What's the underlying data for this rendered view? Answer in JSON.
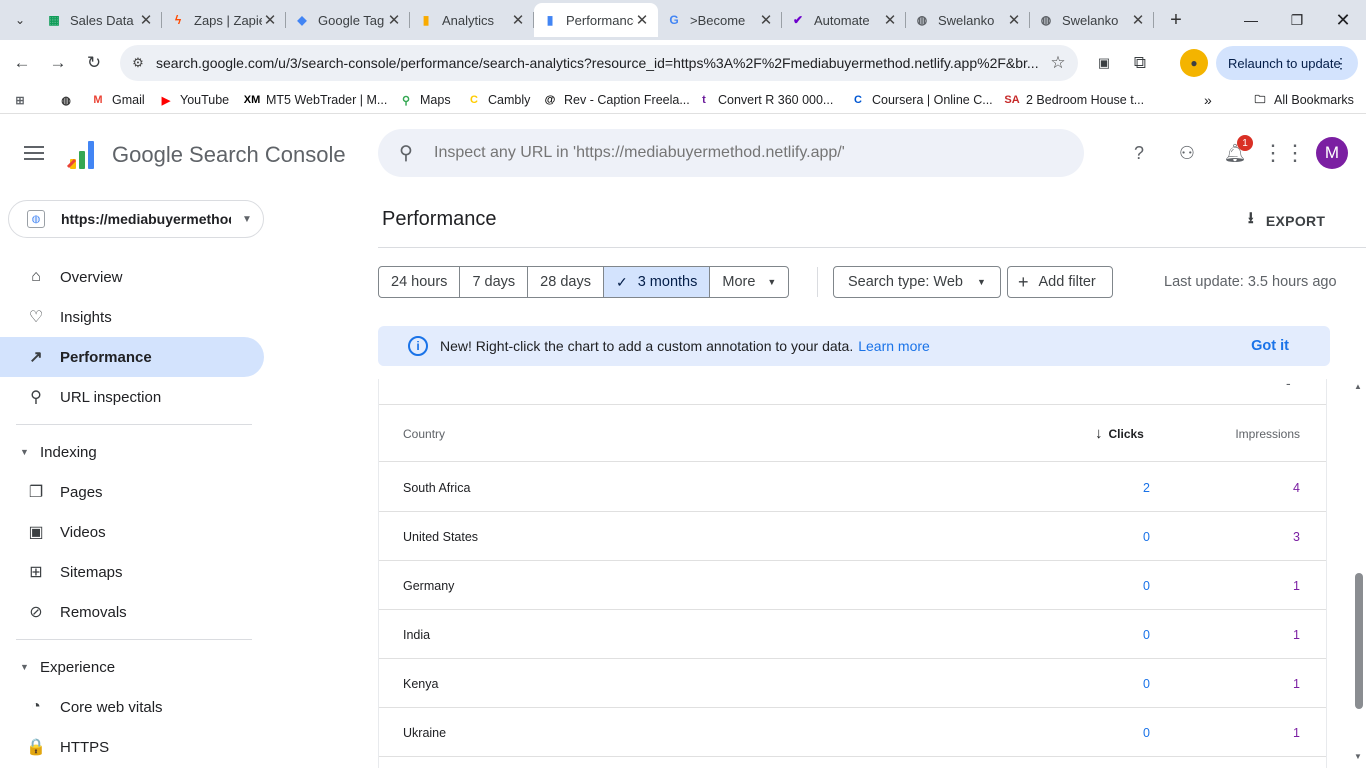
{
  "browser": {
    "tabs": [
      {
        "title": "Sales Data",
        "favicon": "sheets-icon",
        "color": "#0f9d58",
        "glyph": "▦"
      },
      {
        "title": "Zaps | Zapier",
        "favicon": "zapier-icon",
        "color": "#ff4a00",
        "glyph": "ϟ"
      },
      {
        "title": "Google Tag",
        "favicon": "tag-manager-icon",
        "color": "#4285f4",
        "glyph": "◆"
      },
      {
        "title": "Analytics",
        "favicon": "analytics-icon",
        "color": "#f9ab00",
        "glyph": "▮"
      },
      {
        "title": "Performance",
        "favicon": "search-console-icon",
        "color": "#4285f4",
        "glyph": "▮",
        "active": true
      },
      {
        "title": ">Become",
        "favicon": "google-icon",
        "color": "#4285f4",
        "glyph": "G"
      },
      {
        "title": "Automate",
        "favicon": "make-icon",
        "color": "#6d00cc",
        "glyph": "✔"
      },
      {
        "title": "Swelanko",
        "favicon": "globe-icon",
        "color": "#5f6368",
        "glyph": "◍"
      },
      {
        "title": "Swelanko",
        "favicon": "globe-icon",
        "color": "#5f6368",
        "glyph": "◍"
      }
    ],
    "url": "search.google.com/u/3/search-console/performance/search-analytics?resource_id=https%3A%2F%2Fmediabuyermethod.netlify.app%2F&br...",
    "relaunch_label": "Relaunch to update",
    "bookmarks": [
      {
        "label": "",
        "icon": "globe-icon",
        "glyph": "◍",
        "color": "#333"
      },
      {
        "label": "Gmail",
        "icon": "gmail-icon",
        "glyph": "M",
        "color": "#ea4335"
      },
      {
        "label": "YouTube",
        "icon": "youtube-icon",
        "glyph": "▶",
        "color": "#ff0000"
      },
      {
        "label": "MT5 WebTrader | M...",
        "icon": "xm-icon",
        "glyph": "XM",
        "color": "#000"
      },
      {
        "label": "Maps",
        "icon": "maps-icon",
        "glyph": "⚲",
        "color": "#34a853"
      },
      {
        "label": "Cambly",
        "icon": "cambly-icon",
        "glyph": "C",
        "color": "#ffcc00"
      },
      {
        "label": "Rev - Caption Freela...",
        "icon": "rev-icon",
        "glyph": "@",
        "color": "#000"
      },
      {
        "label": "Convert R 360 000...",
        "icon": "t-icon",
        "glyph": "t",
        "color": "#6a1b9a"
      },
      {
        "label": "Coursera | Online C...",
        "icon": "coursera-icon",
        "glyph": "C",
        "color": "#0056d2"
      },
      {
        "label": "2 Bedroom House t...",
        "icon": "sa-icon",
        "glyph": "SA",
        "color": "#c62828"
      }
    ],
    "all_bookmarks_label": "All Bookmarks"
  },
  "header": {
    "product_name": "Google Search Console",
    "search_placeholder": "Inspect any URL in 'https://mediabuyermethod.netlify.app/'",
    "notification_count": "1",
    "avatar_letter": "M"
  },
  "sidebar": {
    "property": "https://mediabuyermethod.netlify.app/",
    "items": [
      {
        "label": "Overview",
        "icon": "home-icon",
        "glyph": "⌂"
      },
      {
        "label": "Insights",
        "icon": "lightbulb-icon",
        "glyph": "♡"
      },
      {
        "label": "Performance",
        "icon": "trending-up-icon",
        "glyph": "↗",
        "active": true
      },
      {
        "label": "URL inspection",
        "icon": "search-icon",
        "glyph": "⚲"
      }
    ],
    "sections": [
      {
        "label": "Indexing",
        "items": [
          {
            "label": "Pages",
            "icon": "pages-icon",
            "glyph": "❐"
          },
          {
            "label": "Videos",
            "icon": "videos-icon",
            "glyph": "▣"
          },
          {
            "label": "Sitemaps",
            "icon": "sitemaps-icon",
            "glyph": "⊞"
          },
          {
            "label": "Removals",
            "icon": "removals-icon",
            "glyph": "⊘"
          }
        ]
      },
      {
        "label": "Experience",
        "items": [
          {
            "label": "Core web vitals",
            "icon": "gauge-icon",
            "glyph": "◔"
          },
          {
            "label": "HTTPS",
            "icon": "lock-icon",
            "glyph": "🔒"
          }
        ]
      }
    ]
  },
  "main": {
    "title": "Performance",
    "export_label": "EXPORT",
    "date_ranges": [
      "24 hours",
      "7 days",
      "28 days",
      "3 months",
      "More"
    ],
    "selected_range": "3 months",
    "search_type_label": "Search type: Web",
    "add_filter_label": "Add filter",
    "last_update": "Last update: 3.5 hours ago",
    "banner": {
      "text": "New! Right-click the chart to add a custom annotation to your data.",
      "link": "Learn more",
      "dismiss": "Got it"
    },
    "table": {
      "top_marker": "-",
      "headers": {
        "country": "Country",
        "clicks": "Clicks",
        "impressions": "Impressions"
      },
      "rows": [
        {
          "country": "South Africa",
          "clicks": "2",
          "impressions": "4"
        },
        {
          "country": "United States",
          "clicks": "0",
          "impressions": "3"
        },
        {
          "country": "Germany",
          "clicks": "0",
          "impressions": "1"
        },
        {
          "country": "India",
          "clicks": "0",
          "impressions": "1"
        },
        {
          "country": "Kenya",
          "clicks": "0",
          "impressions": "1"
        },
        {
          "country": "Ukraine",
          "clicks": "0",
          "impressions": "1"
        }
      ]
    }
  },
  "colors": {
    "accent": "#1a73e8",
    "active_nav": "#d3e3fd",
    "impressions": "#7b1fa2"
  }
}
